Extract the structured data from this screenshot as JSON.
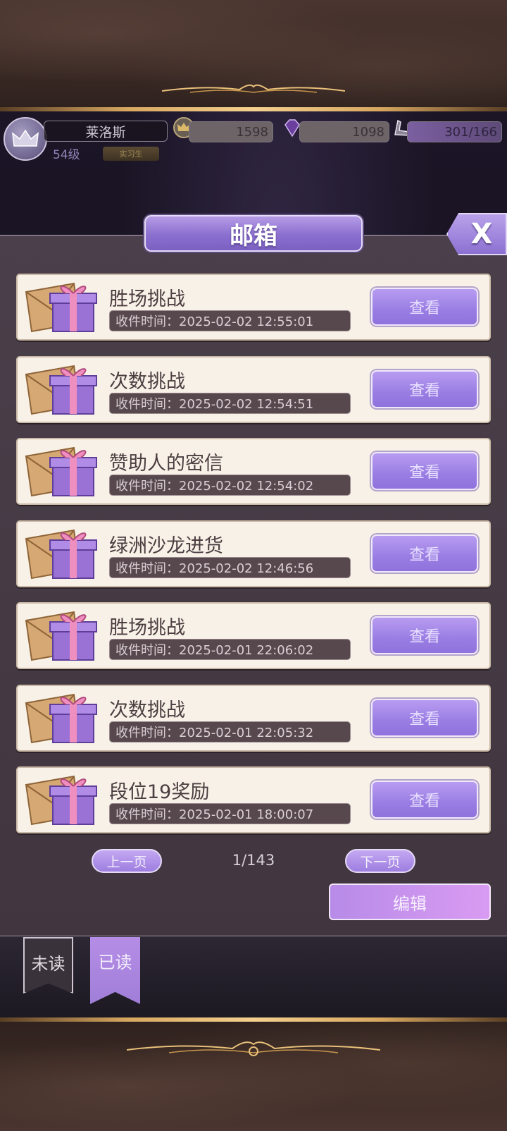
{
  "player": {
    "name": "莱洛斯",
    "level": "54级",
    "title_badge": "实习生"
  },
  "resources": {
    "crowns": "1598",
    "gems": "1098",
    "stamina": "301/166"
  },
  "dialog": {
    "title": "邮箱",
    "close_label": "X"
  },
  "mails": [
    {
      "title": "胜场挑战",
      "time": "收件时间：2025-02-02 12:55:01",
      "button": "查看"
    },
    {
      "title": "次数挑战",
      "time": "收件时间：2025-02-02 12:54:51",
      "button": "查看"
    },
    {
      "title": "赞助人的密信",
      "time": "收件时间：2025-02-02 12:54:02",
      "button": "查看"
    },
    {
      "title": "绿洲沙龙进货",
      "time": "收件时间：2025-02-02 12:46:56",
      "button": "查看"
    },
    {
      "title": "胜场挑战",
      "time": "收件时间：2025-02-01 22:06:02",
      "button": "查看"
    },
    {
      "title": "次数挑战",
      "time": "收件时间：2025-02-01 22:05:32",
      "button": "查看"
    },
    {
      "title": "段位19奖励",
      "time": "收件时间：2025-02-01 18:00:07",
      "button": "查看"
    }
  ],
  "pager": {
    "prev": "上一页",
    "indicator": "1/143",
    "next": "下一页"
  },
  "edit_label": "编辑",
  "tabs": {
    "unread": "未读",
    "read": "已读"
  },
  "colors": {
    "accent_purple": "#9a7de3",
    "panel_bg": "#41363f",
    "mail_card_bg": "#f8f1e7",
    "gold_trim": "#d7a760"
  }
}
